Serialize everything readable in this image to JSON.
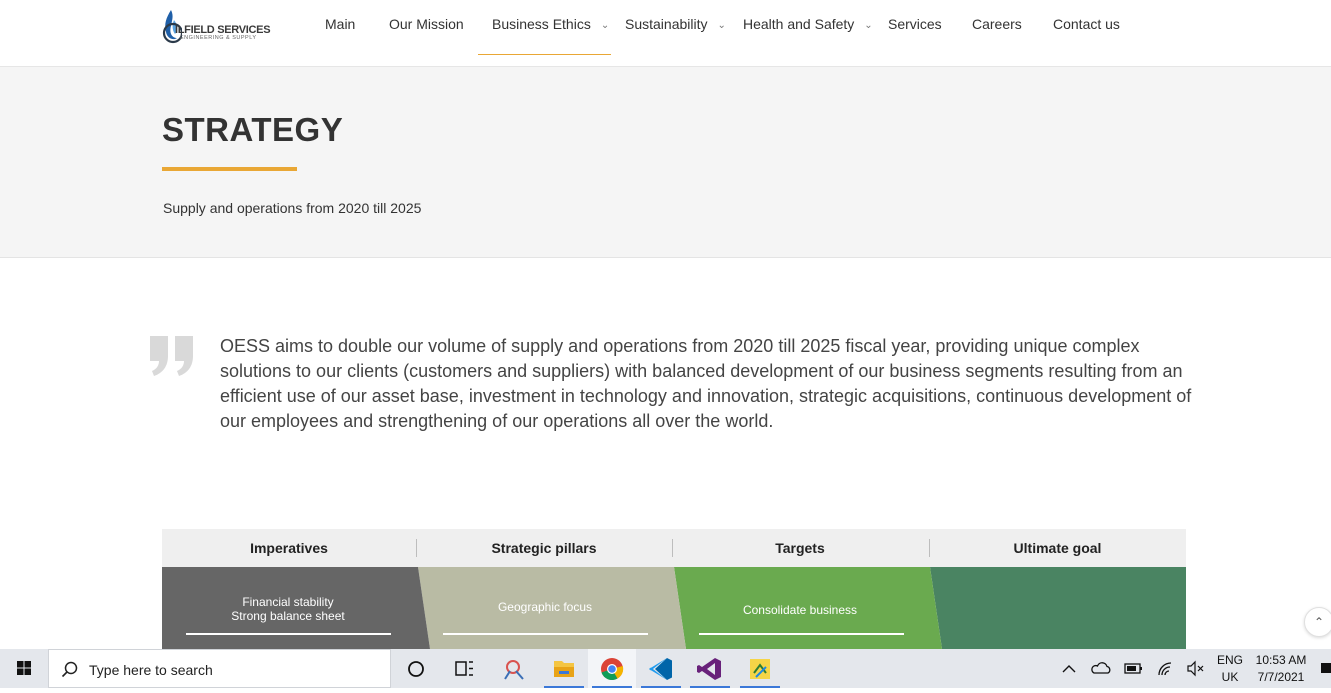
{
  "logo": {
    "line1": "ILFIELD SERVICES",
    "line2": "ENGINEERING & SUPPLY"
  },
  "nav": {
    "items": [
      {
        "label": "Main"
      },
      {
        "label": "Our Mission"
      },
      {
        "label": "Business Ethics"
      },
      {
        "label": "Sustainability"
      },
      {
        "label": "Health and Safety"
      },
      {
        "label": "Services"
      },
      {
        "label": "Careers"
      },
      {
        "label": "Contact us"
      }
    ],
    "active": "Business Ethics"
  },
  "hero": {
    "title": "STRATEGY",
    "subtitle": "Supply and operations from 2020 till 2025"
  },
  "quote": {
    "text": "OESS aims to double our volume of supply and operations from 2020 till 2025 fiscal year, providing unique complex solutions to our clients (customers and suppliers) with balanced development of our business segments resulting from an efficient use of our asset base, investment in technology and innovation, strategic acquisitions, continuous development of our employees and strengthening of our operations all over the world."
  },
  "strategy": {
    "columns": [
      "Imperatives",
      "Strategic pillars",
      "Targets",
      "Ultimate goal"
    ],
    "labels": {
      "imperatives": [
        "Financial stability",
        "Strong balance sheet"
      ],
      "pillars": "Geographic focus",
      "targets": "Consolidate business"
    },
    "colors": {
      "imperatives": "#666666",
      "pillars": "#b9bba4",
      "targets": "#6aaa4f",
      "goal": "#4a8462"
    }
  },
  "taskbar": {
    "search_placeholder": "Type here to search",
    "lang_top": "ENG",
    "lang_bottom": "UK",
    "time": "10:53 AM",
    "date": "7/7/2021"
  }
}
